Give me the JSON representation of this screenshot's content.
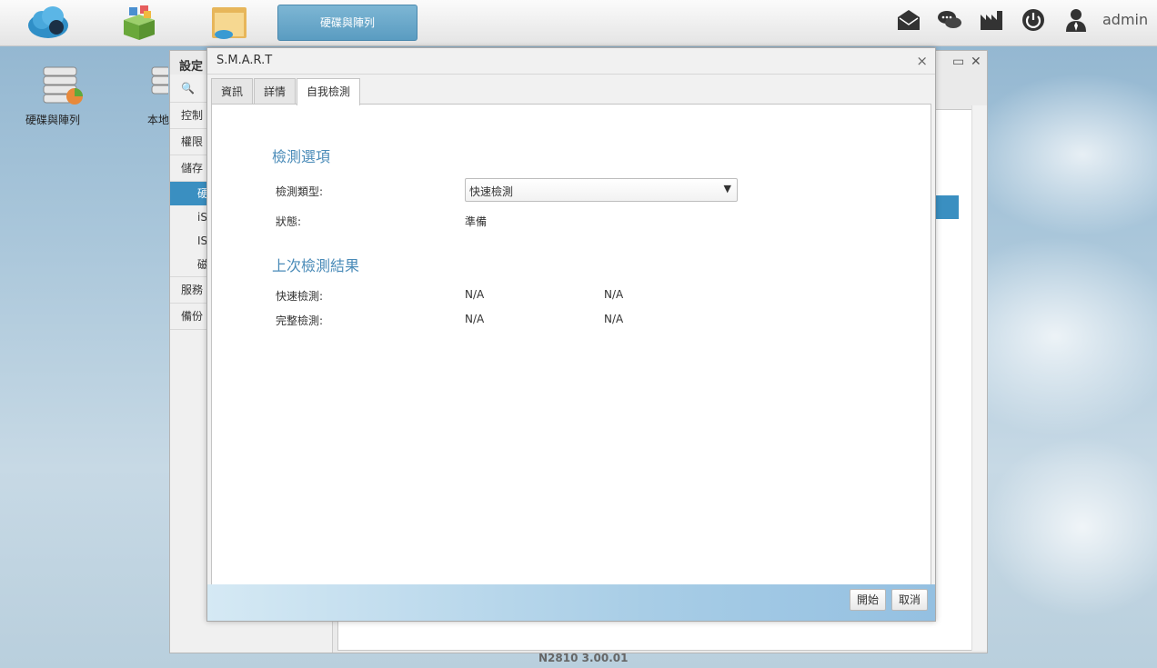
{
  "taskbar": {
    "active_app": "硬碟與陣列",
    "user": "admin",
    "icons": [
      "cloud-icon",
      "apps-box-icon",
      "folder-icon"
    ],
    "right_icons": [
      "mail-icon",
      "chat-icon",
      "factory-icon",
      "power-icon",
      "user-icon"
    ]
  },
  "desktop": {
    "icons": [
      {
        "label": "硬碟與陣列",
        "icon": "disk-array-icon"
      },
      {
        "label": "本地",
        "icon": "local-icon"
      }
    ]
  },
  "bgwindow": {
    "title": "設定",
    "search_glyph": "🔍",
    "sidebar": [
      {
        "label": "控制",
        "type": "section"
      },
      {
        "label": "權限",
        "type": "section"
      },
      {
        "label": "儲存",
        "type": "section"
      },
      {
        "label": "硬",
        "type": "item",
        "selected": true
      },
      {
        "label": "iS",
        "type": "item"
      },
      {
        "label": "IS",
        "type": "item"
      },
      {
        "label": "磁",
        "type": "item"
      },
      {
        "label": "服務",
        "type": "section"
      },
      {
        "label": "備份",
        "type": "section"
      }
    ],
    "version": "N2810   3.00.01"
  },
  "dialog": {
    "title": "S.M.A.R.T",
    "close_glyph": "×",
    "tabs": [
      "資訊",
      "詳情",
      "自我檢測"
    ],
    "active_tab": "自我檢測",
    "options_heading": "檢測選項",
    "test_type_label": "檢測類型:",
    "test_type_value": "快速檢測",
    "status_label": "狀態:",
    "status_value": "準備",
    "results_heading": "上次檢測結果",
    "results": [
      {
        "label": "快速檢測:",
        "col1": "N/A",
        "col2": "N/A"
      },
      {
        "label": "完整檢測:",
        "col1": "N/A",
        "col2": "N/A"
      }
    ],
    "start_button": "開始",
    "cancel_button": "取消"
  },
  "colors": {
    "accent": "#3a8fc1",
    "heading": "#4a8bb8"
  }
}
